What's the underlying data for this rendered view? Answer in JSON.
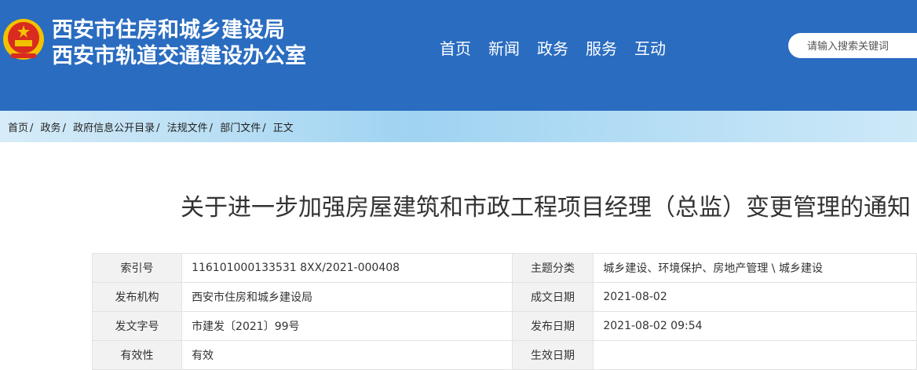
{
  "header": {
    "org_line1": "西安市住房和城乡建设局",
    "org_line2": "西安市轨道交通建设办公室",
    "nav": [
      "首页",
      "新闻",
      "政务",
      "服务",
      "互动"
    ],
    "search_placeholder": "请输入搜索关键词",
    "brand_color": "#2a6cc0"
  },
  "breadcrumb": {
    "items": [
      "首页",
      "政务",
      "政府信息公开目录",
      "法规文件",
      "部门文件",
      "正文"
    ],
    "separator": "/"
  },
  "document": {
    "title": "关于进一步加强房屋建筑和市政工程项目经理（总监）变更管理的通知",
    "meta_rows": [
      {
        "l1": "索引号",
        "v1": "116101000133531 8XX/2021-000408",
        "l2": "主题分类",
        "v2": "城乡建设、环境保护、房地产管理 \\ 城乡建设"
      },
      {
        "l1": "发布机构",
        "v1": "西安市住房和城乡建设局",
        "l2": "成文日期",
        "v2": "2021-08-02"
      },
      {
        "l1": "发文字号",
        "v1": "市建发〔2021〕99号",
        "l2": "发布日期",
        "v2": "2021-08-02 09:54"
      },
      {
        "l1": "有效性",
        "v1": "有效",
        "l2": "生效日期",
        "v2": ""
      }
    ]
  }
}
